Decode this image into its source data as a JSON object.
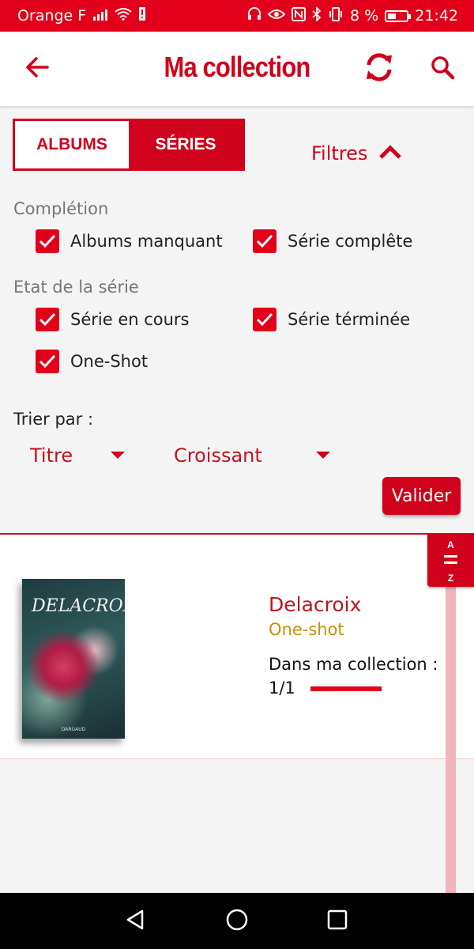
{
  "status_bar": {
    "carrier": "Orange F",
    "battery_percent": "8 %",
    "time": "21:42",
    "icons": [
      "signal-icon",
      "wifi-icon",
      "alert-icon",
      "headset-icon",
      "eye-icon",
      "nfc-icon",
      "bluetooth-icon",
      "vibrate-icon",
      "battery-icon"
    ]
  },
  "header": {
    "title": "Ma collection",
    "back_icon": "arrow-left-icon",
    "refresh_icon": "refresh-icon",
    "search_icon": "search-icon"
  },
  "tabs": [
    {
      "label": "ALBUMS",
      "active": true
    },
    {
      "label": "SÉRIES",
      "active": false
    }
  ],
  "filters_toggle": {
    "label": "Filtres",
    "icon": "chevron-up-icon"
  },
  "completion": {
    "label": "Complétion",
    "options": [
      {
        "label": "Albums manquant",
        "checked": true
      },
      {
        "label": "Série complête",
        "checked": true
      }
    ]
  },
  "series_state": {
    "label": "Etat de la série",
    "options": [
      {
        "label": "Série en cours",
        "checked": true
      },
      {
        "label": "Série términée",
        "checked": true
      },
      {
        "label": "One-Shot",
        "checked": true
      }
    ]
  },
  "sort": {
    "label": "Trier par :",
    "field": "Titre",
    "order": "Croissant"
  },
  "validate_label": "Valider",
  "collection_items": [
    {
      "title": "Delacroix",
      "type": "One-shot",
      "collection_label": "Dans ma collection :",
      "collection_count": "1/1",
      "progress": 1.0,
      "cover_title": "DELACROIX",
      "cover_publisher": "DARGAUD"
    }
  ],
  "az_scroller": {
    "top": "A",
    "bottom": "Z"
  },
  "colors": {
    "brand_red": "#d0011b",
    "status_red": "#e2001a",
    "type_gold": "#c2920e"
  },
  "nav_bar": [
    "back-triangle-icon",
    "home-circle-icon",
    "recents-square-icon"
  ]
}
